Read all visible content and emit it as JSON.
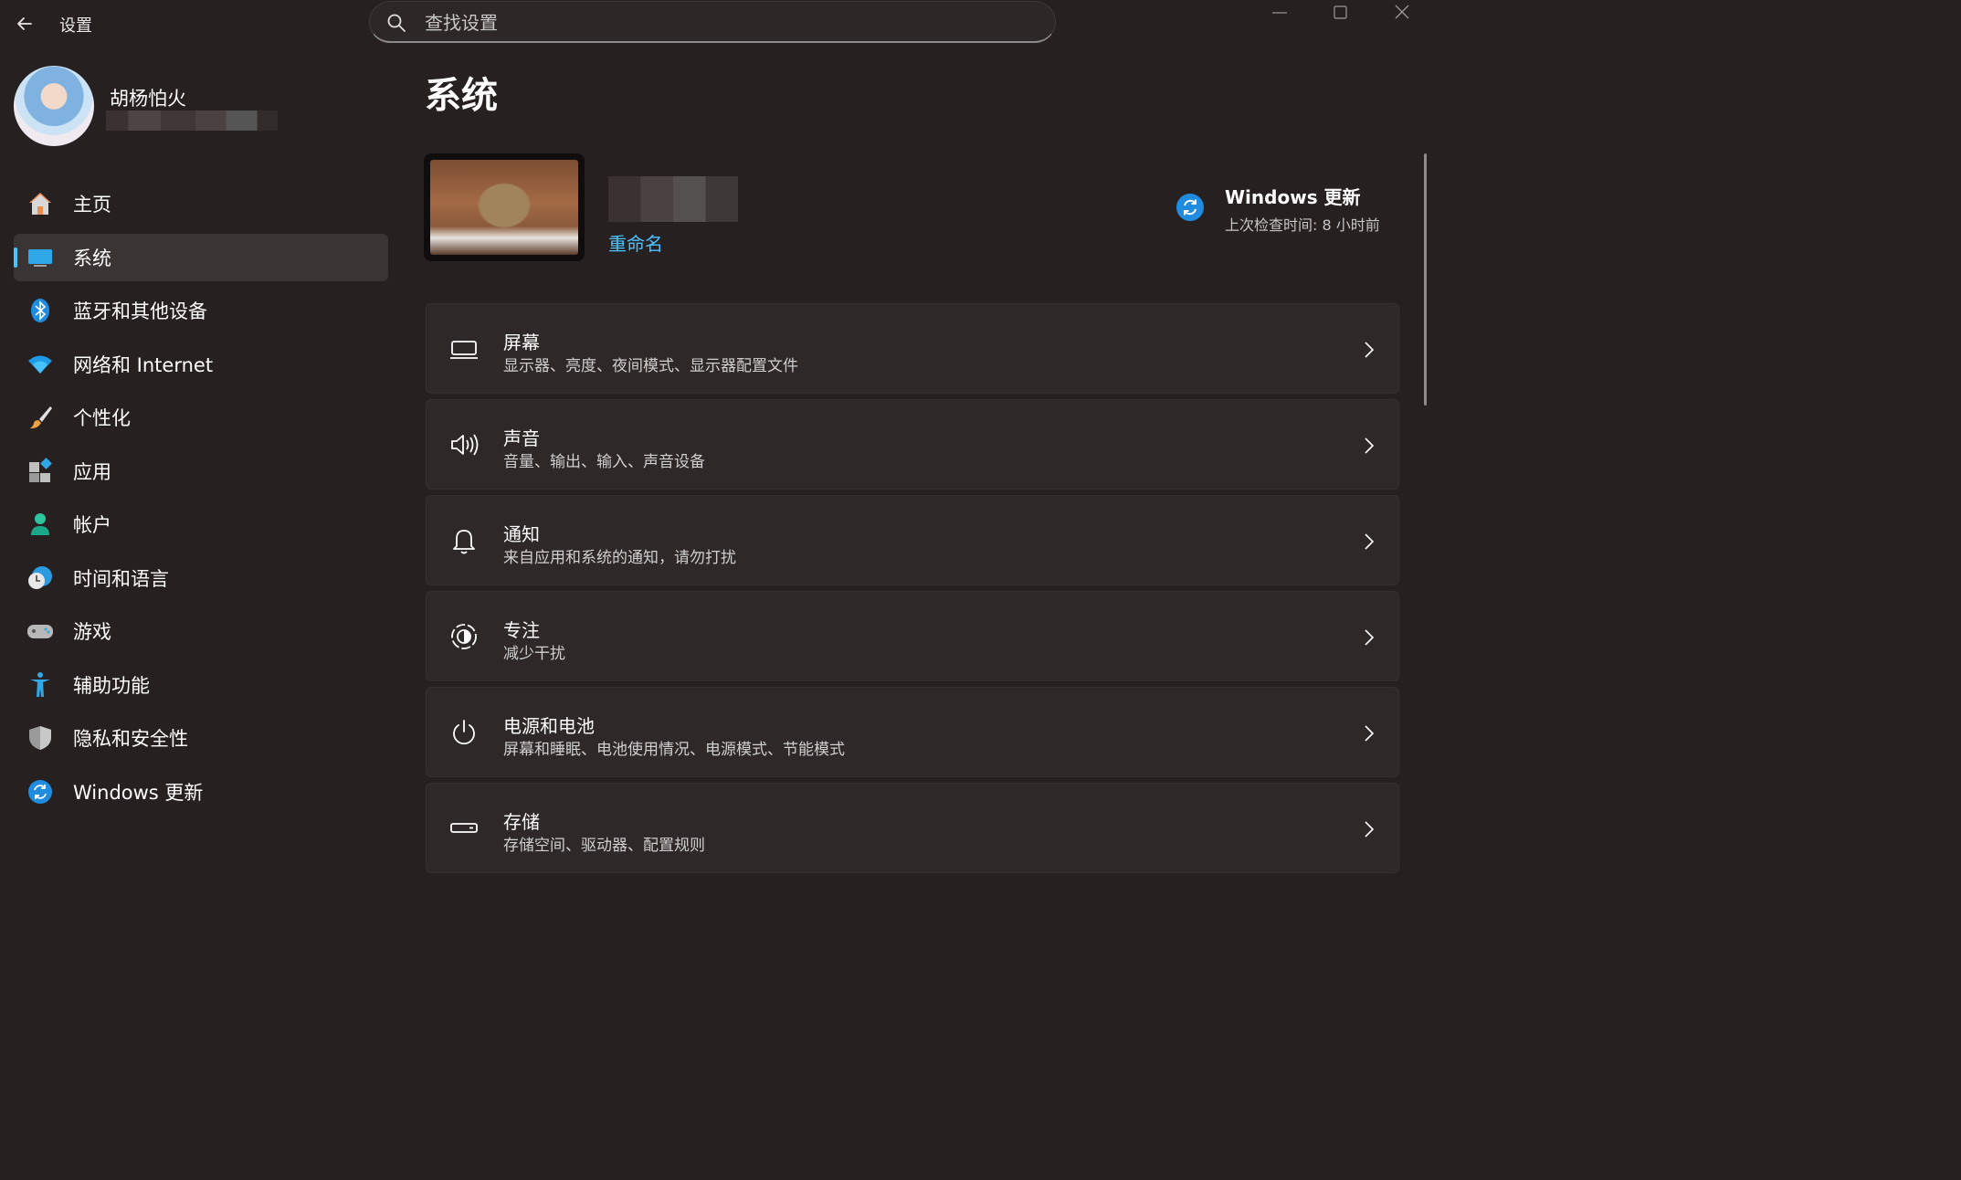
{
  "window": {
    "title": "设置"
  },
  "search": {
    "placeholder": "查找设置"
  },
  "profile": {
    "name": "胡杨怕火"
  },
  "sidebar": {
    "items": [
      {
        "label": "主页",
        "icon": "home-icon"
      },
      {
        "label": "系统",
        "icon": "system-icon",
        "selected": true
      },
      {
        "label": "蓝牙和其他设备",
        "icon": "bluetooth-icon"
      },
      {
        "label": "网络和 Internet",
        "icon": "wifi-icon"
      },
      {
        "label": "个性化",
        "icon": "brush-icon"
      },
      {
        "label": "应用",
        "icon": "apps-icon"
      },
      {
        "label": "帐户",
        "icon": "account-icon"
      },
      {
        "label": "时间和语言",
        "icon": "time-language-icon"
      },
      {
        "label": "游戏",
        "icon": "gamepad-icon"
      },
      {
        "label": "辅助功能",
        "icon": "accessibility-icon"
      },
      {
        "label": "隐私和安全性",
        "icon": "shield-icon"
      },
      {
        "label": "Windows 更新",
        "icon": "windows-update-icon"
      }
    ]
  },
  "main": {
    "title": "系统",
    "device": {
      "rename_label": "重命名"
    },
    "update": {
      "title": "Windows 更新",
      "subtitle": "上次检查时间: 8 小时前"
    },
    "cards": [
      {
        "title": "屏幕",
        "subtitle": "显示器、亮度、夜间模式、显示器配置文件",
        "icon": "display-icon"
      },
      {
        "title": "声音",
        "subtitle": "音量、输出、输入、声音设备",
        "icon": "speaker-icon"
      },
      {
        "title": "通知",
        "subtitle": "来自应用和系统的通知，请勿打扰",
        "icon": "bell-icon"
      },
      {
        "title": "专注",
        "subtitle": "减少干扰",
        "icon": "focus-icon"
      },
      {
        "title": "电源和电池",
        "subtitle": "屏幕和睡眠、电池使用情况、电源模式、节能模式",
        "icon": "power-icon"
      },
      {
        "title": "存储",
        "subtitle": "存储空间、驱动器、配置规则",
        "icon": "storage-icon"
      }
    ]
  },
  "colors": {
    "accent": "#4cc2ff",
    "background": "#272020",
    "card": "#2e2828"
  }
}
